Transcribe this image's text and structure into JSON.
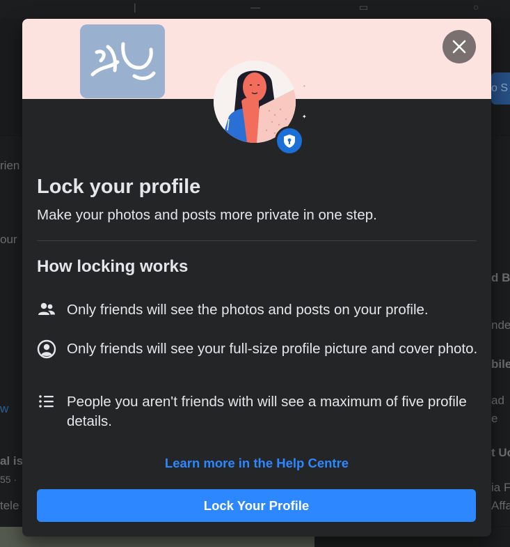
{
  "background": {
    "fragments": [
      "rien",
      "our",
      "d B",
      "nde",
      "bile",
      "ad",
      "e",
      "w",
      "al is",
      "55 ·",
      "tele",
      "t Uc",
      "ia F",
      "Affa",
      "o S"
    ]
  },
  "watermark": {
    "text": "المرجع"
  },
  "modal": {
    "title": "Lock your profile",
    "subtitle": "Make your photos and posts more private in one step.",
    "section_title": "How locking works",
    "items": [
      {
        "icon": "friends-icon",
        "text": "Only friends will see the photos and posts on your profile."
      },
      {
        "icon": "profile-circle-icon",
        "text": "Only friends will see your full-size profile picture and cover photo."
      },
      {
        "icon": "list-icon",
        "text": "People you aren't friends with will see a maximum of five profile details."
      }
    ],
    "help_link": "Learn more in the Help Centre",
    "primary_button": "Lock Your Profile",
    "close_icon": "close-icon"
  },
  "colors": {
    "accent": "#2d88ff",
    "modal_bg": "#242526",
    "banner_bg": "#fce3e0",
    "text": "#e4e6eb"
  }
}
